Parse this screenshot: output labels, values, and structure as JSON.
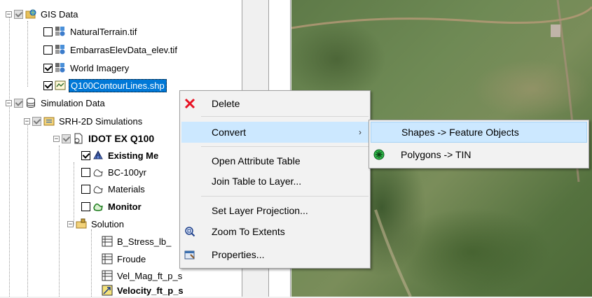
{
  "tree": {
    "gis_data": "GIS Data",
    "natural_terrain": "NaturalTerrain.tif",
    "embarras": "EmbarrasElevData_elev.tif",
    "world_imagery": "World Imagery",
    "contour": "Q100ContourLines.shp",
    "simulation_data": "Simulation Data",
    "srh_sims": "SRH-2D Simulations",
    "idot": "IDOT EX Q100",
    "existing": "Existing Me",
    "bc": "BC-100yr",
    "materials": "Materials",
    "monitor": "Monitor",
    "solution": "Solution",
    "bstress": "B_Stress_lb_",
    "froude": "Froude",
    "velmag": "Vel_Mag_ft_p_s",
    "velocity": "Velocity_ft_p_s"
  },
  "context_menu": {
    "delete": "Delete",
    "convert": "Convert",
    "open_attr": "Open Attribute Table",
    "join": "Join Table to Layer...",
    "set_proj": "Set Layer Projection...",
    "zoom": "Zoom To Extents",
    "properties": "Properties..."
  },
  "submenu": {
    "shapes": "Shapes -> Feature Objects",
    "polygons": "Polygons -> TIN"
  },
  "colors": {
    "selection": "#0078d7",
    "menu_highlight": "#cce8ff",
    "delete_icon": "#e81123"
  }
}
